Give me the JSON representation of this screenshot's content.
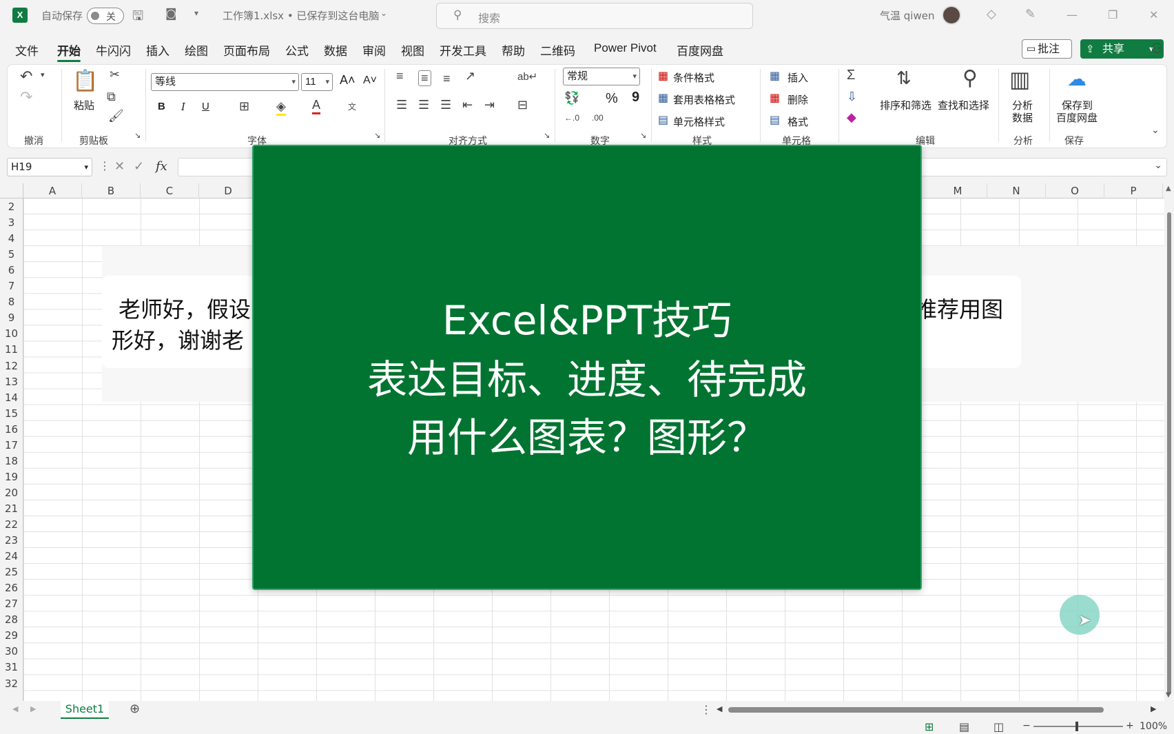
{
  "titlebar": {
    "autosave_label": "自动保存",
    "autosave_state": "关",
    "file_title": "工作簿1.xlsx • 已保存到这台电脑",
    "search_placeholder": "搜索",
    "user_name": "气温 qiwen"
  },
  "menu": {
    "tabs": [
      "文件",
      "开始",
      "牛闪闪",
      "插入",
      "绘图",
      "页面布局",
      "公式",
      "数据",
      "审阅",
      "视图",
      "开发工具",
      "帮助",
      "二维码",
      "Power Pivot",
      "百度网盘"
    ],
    "active_tab": "开始",
    "comment_label": "批注",
    "share_label": "共享"
  },
  "ribbon": {
    "groups": {
      "undo": "撤消",
      "clipboard": "剪贴板",
      "font": "字体",
      "alignment": "对齐方式",
      "number": "数字",
      "styles": "样式",
      "cells": "单元格",
      "editing": "编辑",
      "analysis": "分析",
      "save": "保存"
    },
    "paste_label": "粘贴",
    "font_name": "等线",
    "font_size": "11",
    "bold": "B",
    "italic": "I",
    "underline": "U",
    "number_format": "常规",
    "conditional_format": "条件格式",
    "format_as_table": "套用表格格式",
    "cell_styles": "单元格样式",
    "insert": "插入",
    "delete": "删除",
    "format": "格式",
    "sort_filter": "排序和筛选",
    "find_select": "查找和选择",
    "analyze_data_1": "分析",
    "analyze_data_2": "数据",
    "save_to_1": "保存到",
    "save_to_2": "百度网盘",
    "percent": "%",
    "comma": "9"
  },
  "formula_bar": {
    "name_box": "H19",
    "fx": "fx",
    "value": ""
  },
  "grid": {
    "columns": [
      "A",
      "B",
      "C",
      "D",
      "M",
      "N",
      "O",
      "P"
    ],
    "rows": [
      "2",
      "3",
      "4",
      "5",
      "6",
      "7",
      "8",
      "9",
      "10",
      "11",
      "12",
      "13",
      "14",
      "15",
      "16",
      "17",
      "18",
      "19",
      "20",
      "21",
      "22",
      "23",
      "24",
      "25",
      "26",
      "27",
      "28",
      "29",
      "30",
      "31",
      "32"
    ]
  },
  "question_image": {
    "line1_left": "老师好，假设",
    "line1_right": "推荐用图",
    "line2_left": "形好，谢谢老"
  },
  "overlay": {
    "line1": "Excel&PPT技巧",
    "line2": "表达目标、进度、待完成",
    "line3": "用什么图表？图形？"
  },
  "sheets": {
    "active": "Sheet1"
  },
  "status": {
    "zoom": "100%"
  },
  "colors": {
    "excel_green": "#107c41",
    "overlay_green": "#027431"
  }
}
